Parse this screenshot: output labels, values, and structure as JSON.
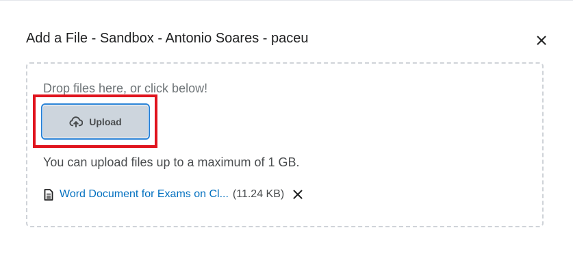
{
  "dialog": {
    "title": "Add a File - Sandbox - Antonio Soares - paceu",
    "close_icon": "close-icon"
  },
  "dropzone": {
    "instruction": "Drop files here, or click below!",
    "upload_label": "Upload",
    "upload_icon": "cloud-upload-icon",
    "limit_text": "You can upload files up to a maximum of 1 GB."
  },
  "file": {
    "icon": "document-icon",
    "name": "Word Document for Exams on Cl...",
    "size": "(11.24 KB)",
    "remove_icon": "remove-icon"
  },
  "colors": {
    "link": "#006fbf",
    "highlight": "#e0141e",
    "button_border": "#2b83d6",
    "button_bg": "#cdd5dd"
  }
}
